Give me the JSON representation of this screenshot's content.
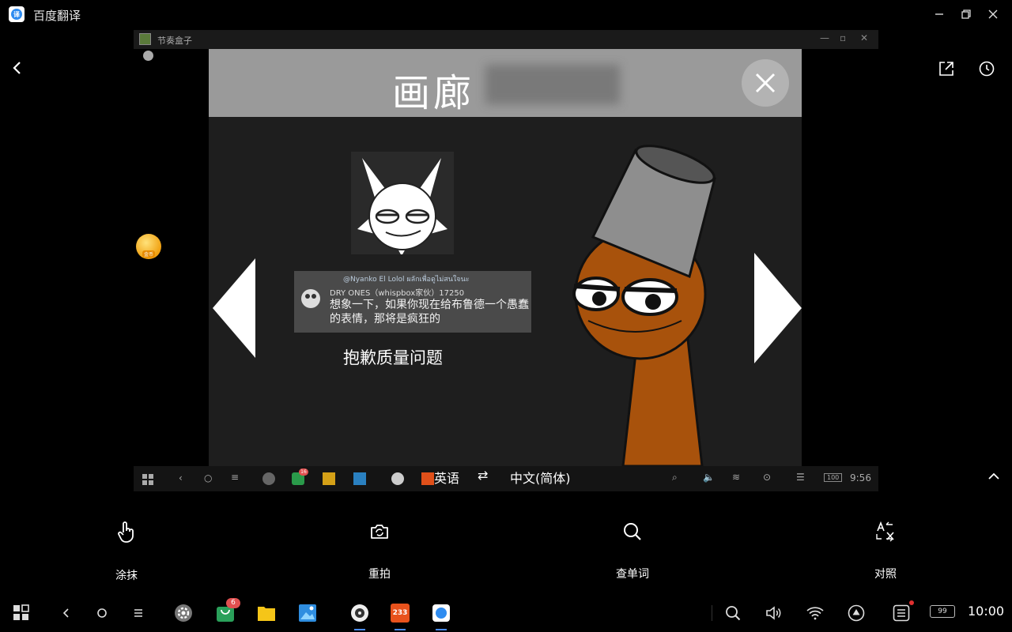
{
  "app": {
    "title": "百度翻译"
  },
  "inner_window": {
    "title": "节奏盒子"
  },
  "game": {
    "title": "画廊",
    "comment": {
      "user": "@Nyanko El Lolol ผลักเพื่อดูไม่สนใจนะ",
      "meta": "DRY ONES（whispbox家伙）17250",
      "text": "想象一下，如果你现在给布鲁德一个愚蠢的表情，那将是疯狂的"
    },
    "apology": "抱歉质量问题"
  },
  "inner_taskbar": {
    "clock": "9:56",
    "battery": "100",
    "badge": "16"
  },
  "language": {
    "source": "英语",
    "swap": "⇄",
    "target": "中文(简体)"
  },
  "tools": [
    {
      "label": "涂抹",
      "icon": "hand-pointer-icon"
    },
    {
      "label": "重拍",
      "icon": "camera-retake-icon"
    },
    {
      "label": "查单词",
      "icon": "search-icon"
    },
    {
      "label": "对照",
      "icon": "compare-translate-icon"
    }
  ],
  "taskbar": {
    "clock": "10:00",
    "battery": "99",
    "notification_badge": "6",
    "app_233_label": "233"
  },
  "colors": {
    "accent": "#4a8cff",
    "background": "#000000",
    "character_orange": "#a8520c"
  }
}
